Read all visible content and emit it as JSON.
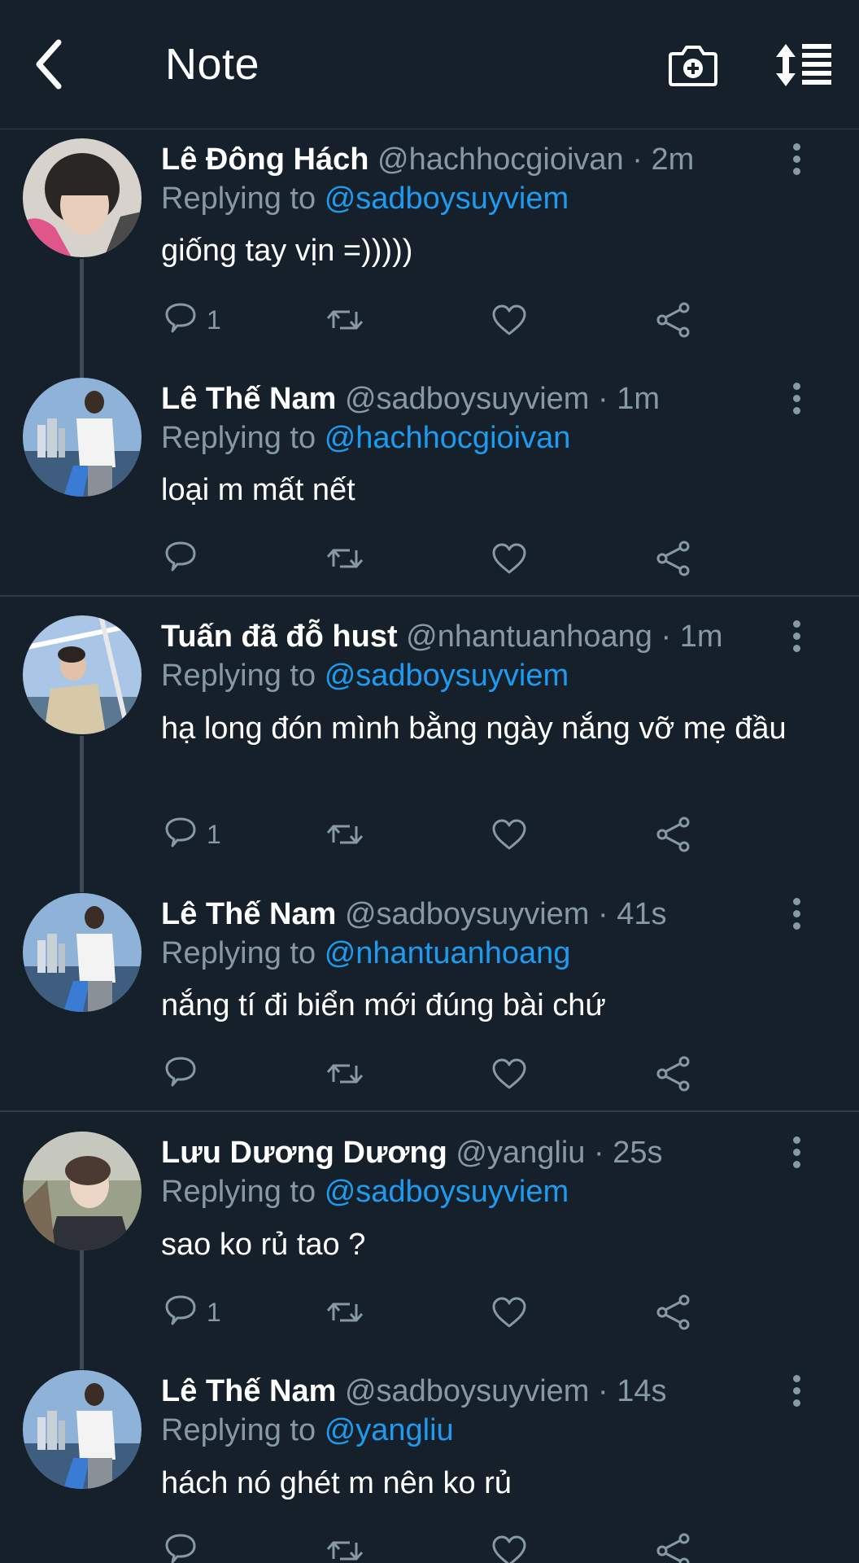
{
  "header": {
    "title": "Note",
    "back_icon": "chevron-left-icon",
    "camera_icon": "camera-plus-icon",
    "sort_icon": "sort-list-icon"
  },
  "colors": {
    "background": "#15202b",
    "muted": "#8899a6",
    "link": "#1d9bf0",
    "divider": "#2f3b47"
  },
  "tweets": [
    {
      "name": "Lê Đông Hách",
      "handle": "@hachhocgioivan",
      "time": "· 2m",
      "replying_label": "Replying to",
      "replying_to": "@sadboysuyviem",
      "text": "giống tay vịn =)))))",
      "reply_count": "1"
    },
    {
      "name": "Lê Thế Nam",
      "handle": "@sadboysuyviem",
      "time": "· 1m",
      "replying_label": "Replying to",
      "replying_to": "@hachhocgioivan",
      "text": "loại m mất nết",
      "reply_count": ""
    },
    {
      "name": "Tuấn đã đỗ hust",
      "handle": "@nhantuanhoang",
      "time": "· 1m",
      "replying_label": "Replying to",
      "replying_to": "@sadboysuyviem",
      "text": "hạ long đón mình bằng ngày nắng vỡ mẹ đầu",
      "reply_count": "1"
    },
    {
      "name": "Lê Thế Nam",
      "handle": "@sadboysuyviem",
      "time": "· 41s",
      "replying_label": "Replying to",
      "replying_to": "@nhantuanhoang",
      "text": "nắng tí đi biển mới đúng bài chứ",
      "reply_count": ""
    },
    {
      "name": "Lưu Dương Dương",
      "handle": "@yangliu",
      "time": "· 25s",
      "replying_label": "Replying to",
      "replying_to": "@sadboysuyviem",
      "text": "sao ko rủ tao ?",
      "reply_count": "1"
    },
    {
      "name": "Lê Thế Nam",
      "handle": "@sadboysuyviem",
      "time": "· 14s",
      "replying_label": "Replying to",
      "replying_to": "@yangliu",
      "text": "hách nó ghét m nên ko rủ",
      "reply_count": ""
    }
  ]
}
